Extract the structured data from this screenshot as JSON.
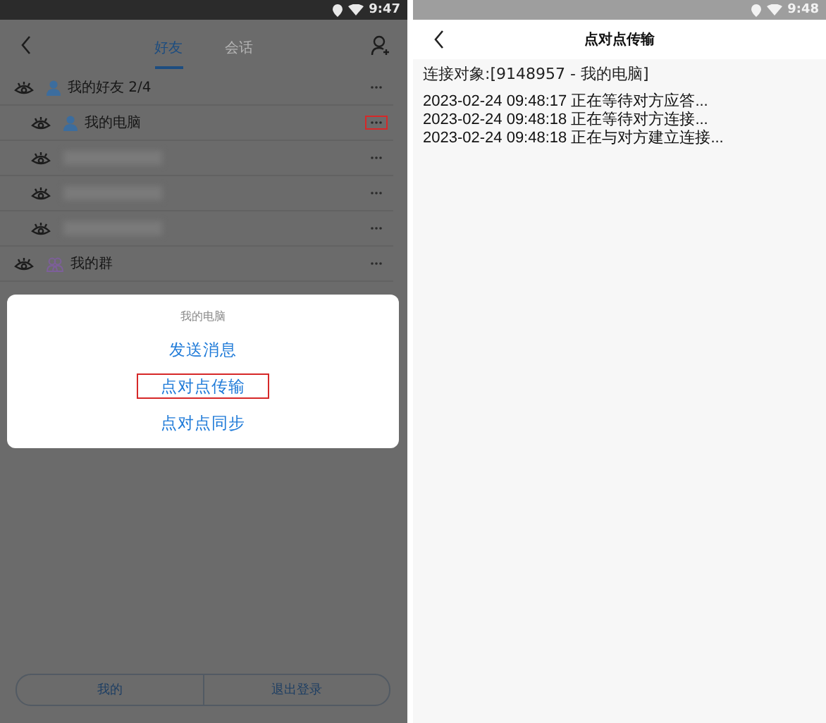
{
  "friends_screen": {
    "status_time": "9:47",
    "tabs": [
      {
        "label": "好友",
        "selected": true
      },
      {
        "label": "会话",
        "selected": false
      }
    ],
    "list": [
      {
        "kind": "friend_group",
        "name": "我的好友 2/4",
        "children": [
          {
            "kind": "contact",
            "name": "我的电脑",
            "highlighted": true
          },
          {
            "kind": "redacted",
            "highlighted": false
          },
          {
            "kind": "redacted",
            "highlighted": false
          },
          {
            "kind": "redacted",
            "highlighted": false
          }
        ]
      },
      {
        "kind": "chat_group",
        "name": "我的群"
      }
    ],
    "dialog": {
      "title": "我的电脑",
      "options": [
        {
          "label": "发送消息",
          "highlighted": false
        },
        {
          "label": "点对点传输",
          "highlighted": true
        },
        {
          "label": "点对点同步",
          "highlighted": false
        }
      ]
    },
    "bottom_buttons": [
      "我的",
      "退出登录"
    ]
  },
  "transfer_screen": {
    "status_time": "9:48",
    "title": "点对点传输",
    "target": "连接对象:[9148957 - 我的电脑]",
    "log": [
      "2023-02-24  09:48:17 正在等待对方应答...",
      "2023-02-24  09:48:18 正在等待对方连接...",
      "2023-02-24  09:48:18 正在与对方建立连接..."
    ]
  }
}
